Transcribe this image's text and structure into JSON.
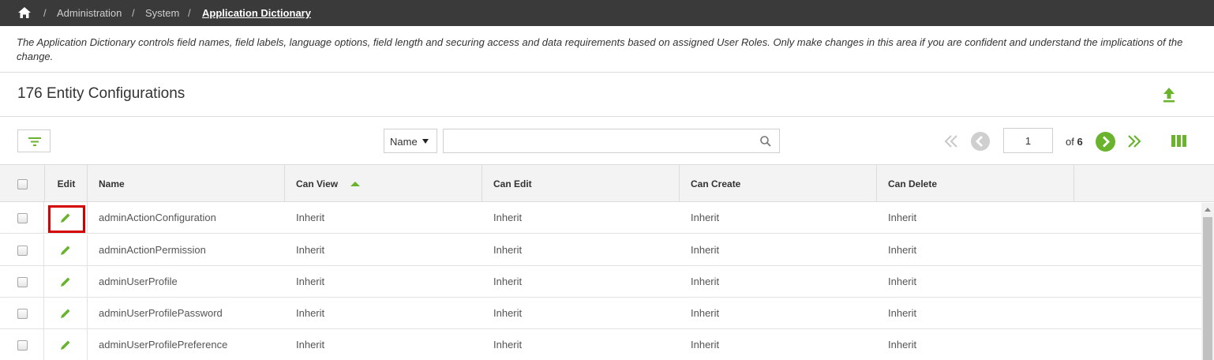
{
  "breadcrumb": {
    "items": [
      "Administration",
      "System",
      "Application Dictionary"
    ],
    "separator": "/"
  },
  "description": "The Application Dictionary controls field names, field labels, language options, field length and securing access and data requirements based on assigned User Roles. Only make changes in this area if you are confident and understand the implications of the change.",
  "title": "176 Entity Configurations",
  "toolbar": {
    "search_field": "Name",
    "search_value": "",
    "page_current": "1",
    "page_of": "of",
    "page_total": "6"
  },
  "table": {
    "columns": [
      "Edit",
      "Name",
      "Can View",
      "Can Edit",
      "Can Create",
      "Can Delete"
    ],
    "sort_column": "Name",
    "sort_direction": "ascending",
    "rows": [
      {
        "name": "adminActionConfiguration",
        "can_view": "Inherit",
        "can_edit": "Inherit",
        "can_create": "Inherit",
        "can_delete": "Inherit"
      },
      {
        "name": "adminActionPermission",
        "can_view": "Inherit",
        "can_edit": "Inherit",
        "can_create": "Inherit",
        "can_delete": "Inherit"
      },
      {
        "name": "adminUserProfile",
        "can_view": "Inherit",
        "can_edit": "Inherit",
        "can_create": "Inherit",
        "can_delete": "Inherit"
      },
      {
        "name": "adminUserProfilePassword",
        "can_view": "Inherit",
        "can_edit": "Inherit",
        "can_create": "Inherit",
        "can_delete": "Inherit"
      },
      {
        "name": "adminUserProfilePreference",
        "can_view": "Inherit",
        "can_edit": "Inherit",
        "can_create": "Inherit",
        "can_delete": "Inherit"
      }
    ]
  },
  "icons": {
    "home": "home-icon",
    "upload": "upload-icon",
    "filter": "filter-icon",
    "search": "search-icon",
    "first_page": "first-page-icon",
    "prev_page": "previous-page-icon",
    "next_page": "next-page-icon",
    "last_page": "last-page-icon",
    "columns": "columns-icon",
    "edit": "pencil-icon"
  },
  "colors": {
    "accent": "#6ab42d",
    "topbar": "#3a3a3a",
    "highlight": "#d40000"
  }
}
